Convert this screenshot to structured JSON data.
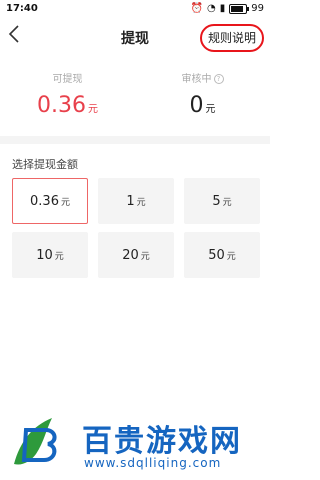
{
  "status_bar": {
    "time": "17:40",
    "battery": "99"
  },
  "nav": {
    "title": "提现",
    "rules_label": "规则说明"
  },
  "balances": {
    "withdrawable": {
      "label": "可提现",
      "value": "0.36",
      "unit": "元"
    },
    "reviewing": {
      "label": "审核中",
      "value": "0",
      "unit": "元"
    }
  },
  "amount_section": {
    "title": "选择提现金额",
    "options": [
      {
        "value": "0.36",
        "unit": "元",
        "selected": true
      },
      {
        "value": "1",
        "unit": "元",
        "selected": false
      },
      {
        "value": "5",
        "unit": "元",
        "selected": false
      },
      {
        "value": "10",
        "unit": "元",
        "selected": false
      },
      {
        "value": "20",
        "unit": "元",
        "selected": false
      },
      {
        "value": "50",
        "unit": "元",
        "selected": false
      }
    ]
  },
  "watermark": {
    "text": "百贵游戏网",
    "url": "www.sdqlliqing.com"
  },
  "colors": {
    "accent_red": "#e8404b",
    "highlight_circle": "#e8151b",
    "watermark_blue": "#1565c0"
  }
}
